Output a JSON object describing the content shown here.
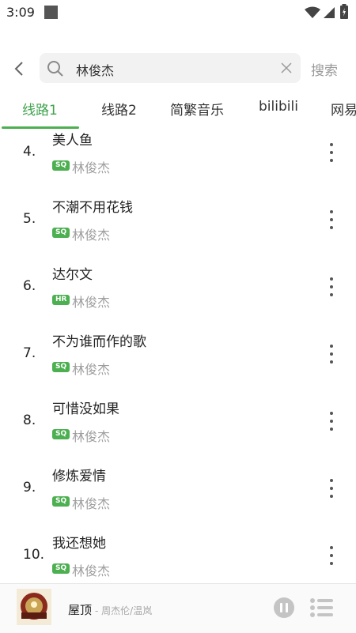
{
  "status_bar": {
    "time": "3:09"
  },
  "search": {
    "query": "林俊杰",
    "button_label": "搜索"
  },
  "tabs": [
    {
      "label": "线路1",
      "active": true
    },
    {
      "label": "线路2",
      "active": false
    },
    {
      "label": "简繁音乐",
      "active": false
    },
    {
      "label": "bilibili",
      "active": false
    },
    {
      "label": "网易",
      "active": false
    }
  ],
  "songs": [
    {
      "index": "4.",
      "title": "美人鱼",
      "quality": "SQ",
      "artist": "林俊杰"
    },
    {
      "index": "5.",
      "title": "不潮不用花钱",
      "quality": "SQ",
      "artist": "林俊杰"
    },
    {
      "index": "6.",
      "title": "达尔文",
      "quality": "HR",
      "artist": "林俊杰"
    },
    {
      "index": "7.",
      "title": "不为谁而作的歌",
      "quality": "SQ",
      "artist": "林俊杰"
    },
    {
      "index": "8.",
      "title": "可惜没如果",
      "quality": "SQ",
      "artist": "林俊杰"
    },
    {
      "index": "9.",
      "title": "修炼爱情",
      "quality": "SQ",
      "artist": "林俊杰"
    },
    {
      "index": "10.",
      "title": "我还想她",
      "quality": "SQ",
      "artist": "林俊杰"
    }
  ],
  "player": {
    "title": "屋顶",
    "artist": "- 周杰伦/温岚"
  },
  "colors": {
    "accent": "#4caf50",
    "active_tab": "#3fa34d"
  }
}
